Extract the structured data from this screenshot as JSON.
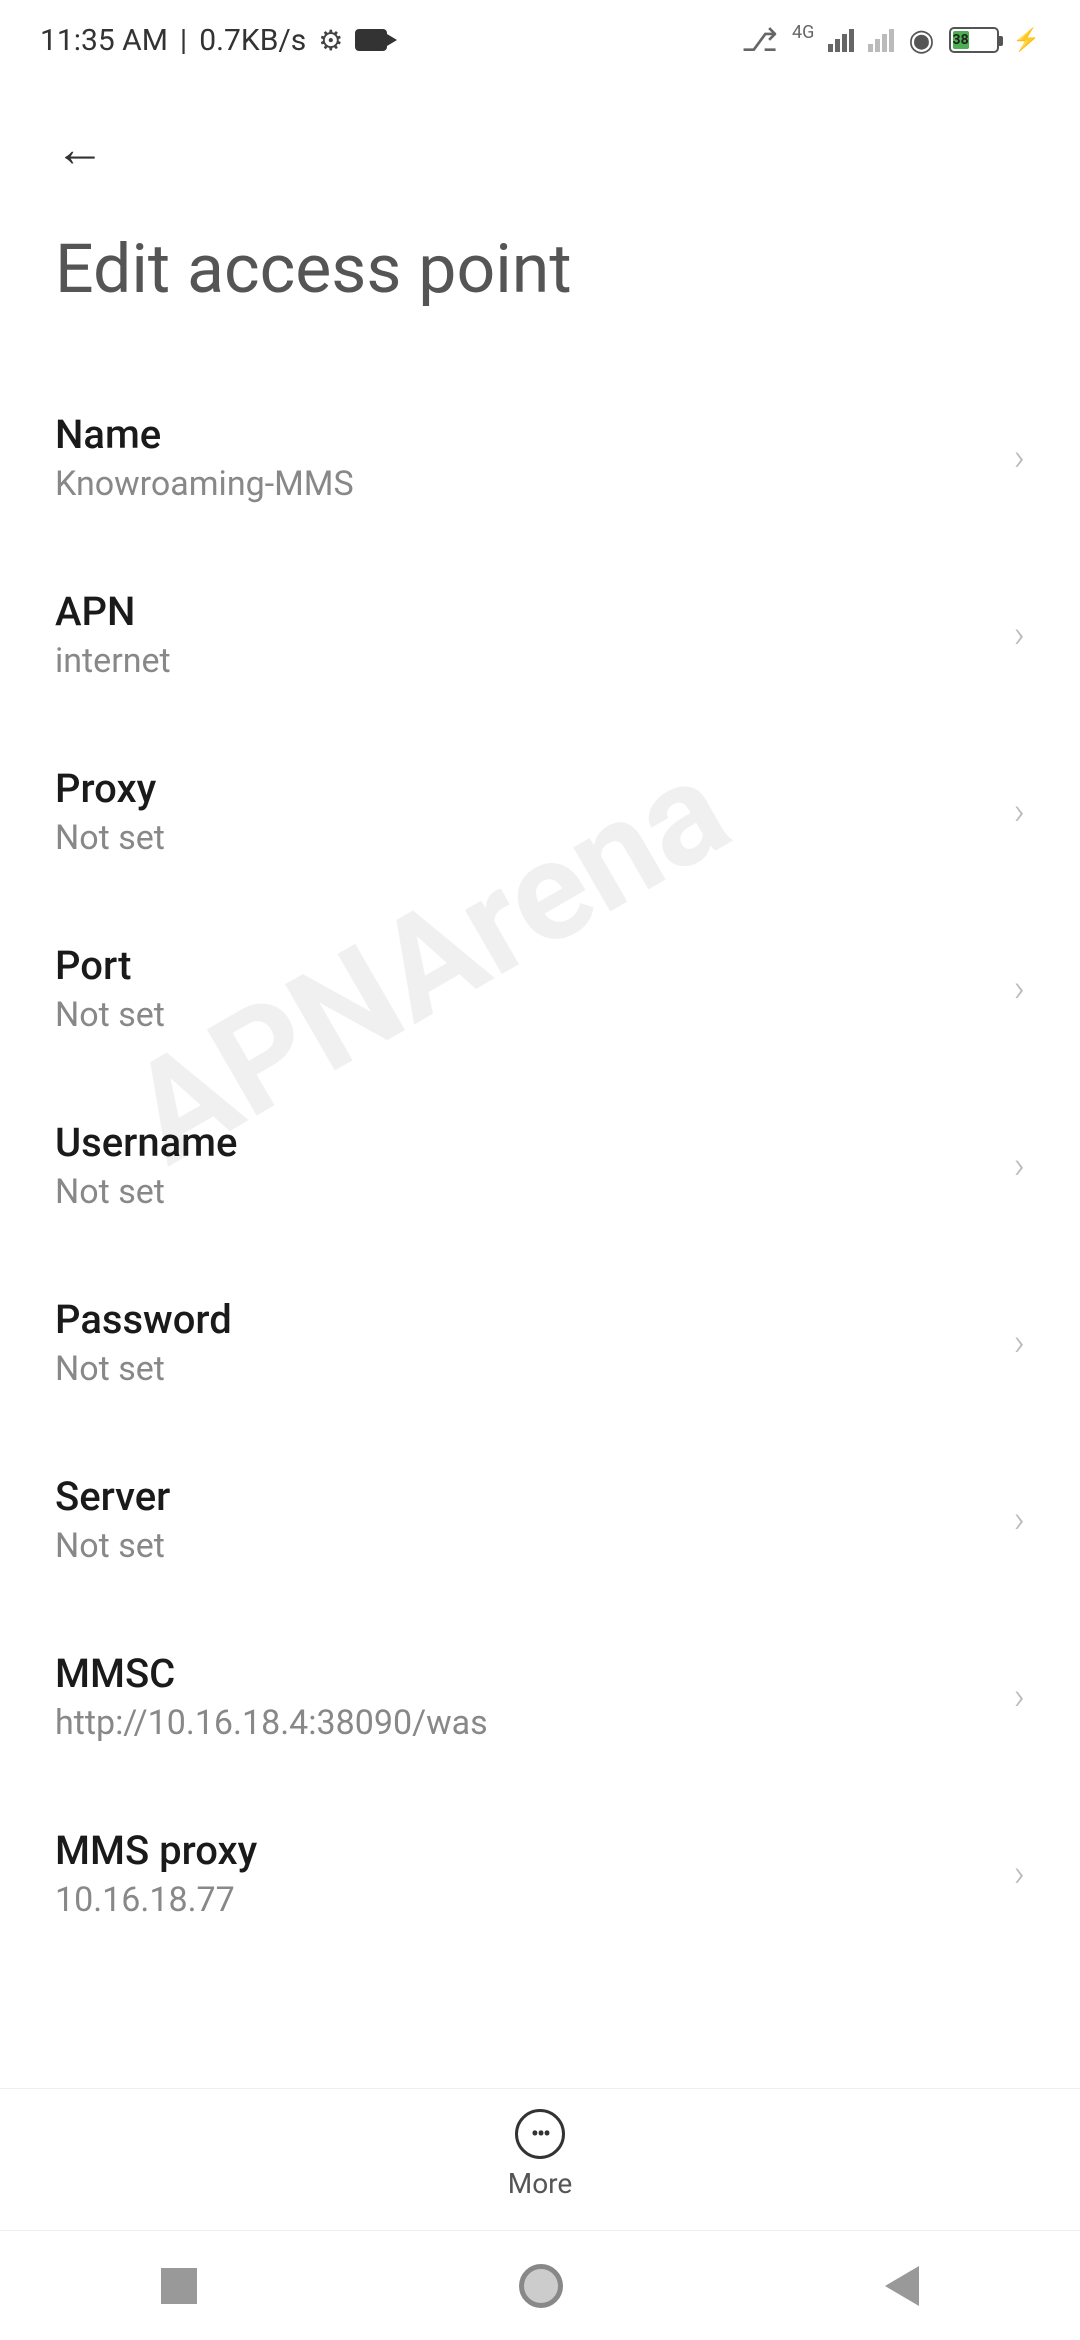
{
  "status_bar": {
    "time": "11:35 AM",
    "data_rate": "0.7KB/s",
    "network_label": "4G",
    "battery_percent": "38"
  },
  "page": {
    "title": "Edit access point"
  },
  "settings": [
    {
      "label": "Name",
      "value": "Knowroaming-MMS"
    },
    {
      "label": "APN",
      "value": "internet"
    },
    {
      "label": "Proxy",
      "value": "Not set"
    },
    {
      "label": "Port",
      "value": "Not set"
    },
    {
      "label": "Username",
      "value": "Not set"
    },
    {
      "label": "Password",
      "value": "Not set"
    },
    {
      "label": "Server",
      "value": "Not set"
    },
    {
      "label": "MMSC",
      "value": "http://10.16.18.4:38090/was"
    },
    {
      "label": "MMS proxy",
      "value": "10.16.18.77"
    }
  ],
  "bottom_bar": {
    "more_label": "More"
  },
  "watermark": "APNArena"
}
